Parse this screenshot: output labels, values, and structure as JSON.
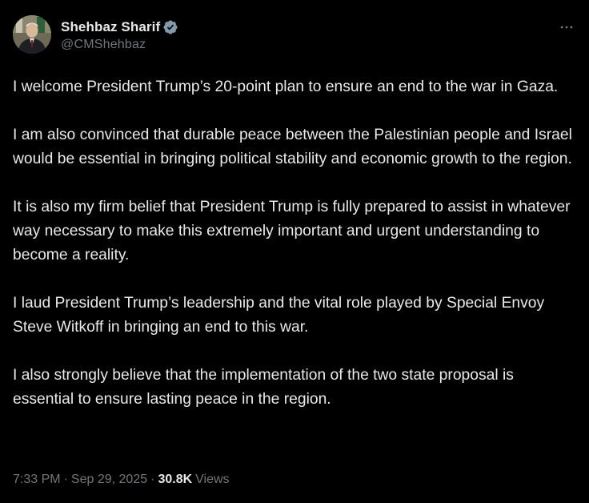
{
  "author": {
    "display_name": "Shehbaz Sharif",
    "handle": "@CMShehbaz",
    "verified": true,
    "verified_badge_color": "#71767b"
  },
  "tweet": {
    "paragraphs": [
      "I welcome President Trump’s 20-point plan to ensure an end to the war in Gaza.",
      "I am also convinced that durable peace between the Palestinian people and Israel would be essential in bringing political stability and economic growth to the region.",
      "It is also my firm belief that President Trump is fully prepared to assist in whatever way necessary to make this extremely important and urgent understanding to become a reality.",
      "I laud President Trump’s leadership and the vital role played by Special Envoy Steve Witkoff in bringing an end to this war.",
      "I also strongly believe that the implementation of the two state proposal is essential to ensure lasting peace in the region."
    ]
  },
  "meta": {
    "time": "7:33 PM",
    "separator": "·",
    "date": "Sep 29, 2025",
    "views_count": "30.8K",
    "views_label": "Views"
  },
  "icons": {
    "avatar": "profile-photo",
    "verified": "verified-badge-icon",
    "more": "more-options-icon"
  },
  "colors": {
    "background": "#000000",
    "primary_text": "#e7e9ea",
    "secondary_text": "#71767b"
  }
}
